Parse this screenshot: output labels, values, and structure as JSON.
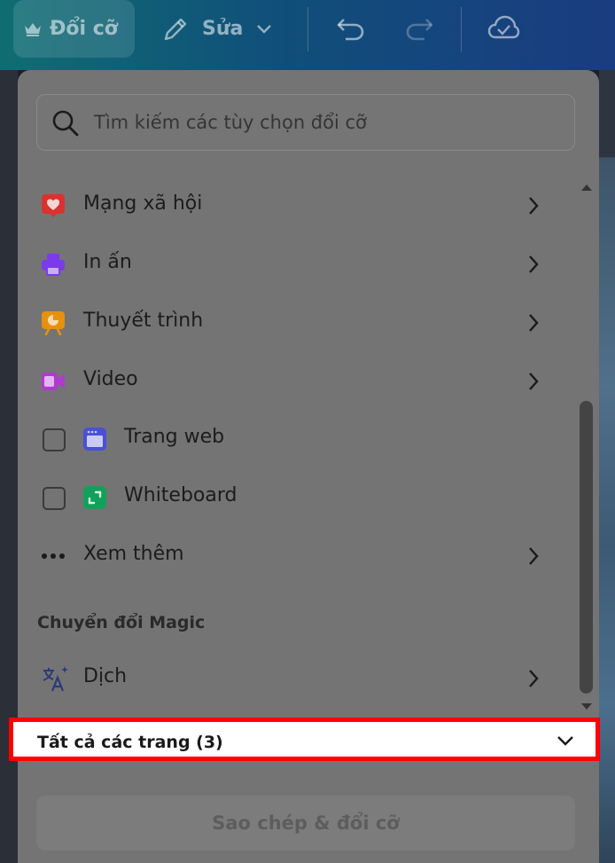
{
  "toolbar": {
    "resize_label": "Đổi cỡ",
    "edit_label": "Sửa"
  },
  "search": {
    "placeholder": "Tìm kiếm các tùy chọn đổi cỡ"
  },
  "menu": {
    "items": [
      {
        "label": "Mạng xã hội",
        "icon": "heart-icon",
        "color": "#d9322f"
      },
      {
        "label": "In ấn",
        "icon": "printer-icon",
        "color": "#7c3aed"
      },
      {
        "label": "Thuyết trình",
        "icon": "presentation-icon",
        "color": "#e8900e"
      },
      {
        "label": "Video",
        "icon": "video-icon",
        "color": "#b03ad0"
      }
    ],
    "checkboxes": [
      {
        "label": "Trang web",
        "icon": "website-icon",
        "color": "#4a4fd6",
        "checked": false
      },
      {
        "label": "Whiteboard",
        "icon": "whiteboard-icon",
        "color": "#14a05a",
        "checked": false
      }
    ],
    "more_label": "Xem thêm"
  },
  "magic": {
    "section_label": "Chuyển đổi Magic",
    "translate_label": "Dịch"
  },
  "pages": {
    "label": "Tất cả các trang (3)"
  },
  "copy_button": {
    "label": "Sao chép & đổi cỡ"
  }
}
